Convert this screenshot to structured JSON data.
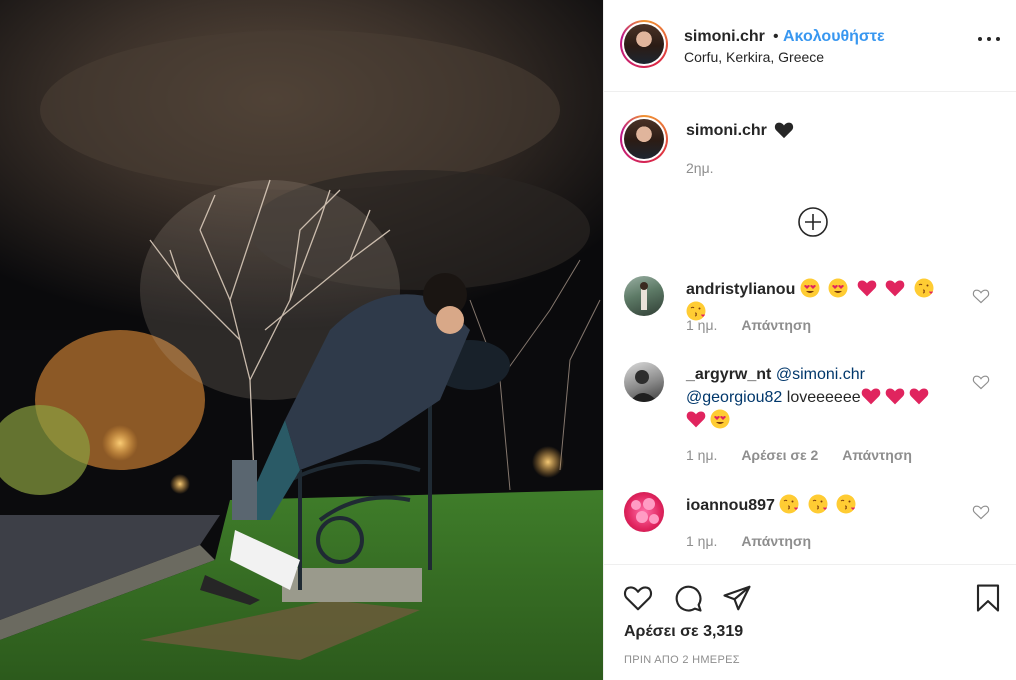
{
  "post": {
    "username": "simoni.chr",
    "dot": "•",
    "follow_label": "Ακολουθήστε",
    "location": "Corfu, Kerkira, Greece"
  },
  "caption": {
    "username": "simoni.chr",
    "emoji": "black-heart",
    "time": "2ημ."
  },
  "comments": [
    {
      "username": "andristylianou",
      "emojis": [
        "heart-eyes",
        "heart-eyes",
        "red-heart",
        "red-heart",
        "kissing-face",
        "kissing-face"
      ],
      "time": "1 ημ.",
      "reply_label": "Απάντηση"
    },
    {
      "username": "_argyrw_nt",
      "mention1": "@simoni.chr",
      "mention2": "@georgiou82",
      "text": "loveeeeee",
      "emojis_line1": [
        "red-heart",
        "red-heart",
        "red-heart"
      ],
      "emojis_line2": [
        "red-heart",
        "heart-eyes"
      ],
      "time": "1 ημ.",
      "likes_label": "Αρέσει σε 2",
      "reply_label": "Απάντηση"
    },
    {
      "username": "ioannou897",
      "emojis": [
        "kissing-face",
        "kissing-face",
        "kissing-face"
      ],
      "time": "1 ημ.",
      "reply_label": "Απάντηση"
    }
  ],
  "footer": {
    "likes": "Αρέσει σε 3,319",
    "date": "ΠΡΙΝ ΑΠΟ 2 ΗΜΕΡΕΣ"
  },
  "icons": {
    "more": "more-options-icon",
    "load_more": "plus-circle-icon",
    "like": "heart-outline-icon",
    "comment": "comment-bubble-icon",
    "share": "paper-plane-icon",
    "save": "bookmark-icon"
  },
  "colors": {
    "follow": "#3897f0",
    "text": "#262626",
    "secondary": "#8e8e8e",
    "mention": "#00376b",
    "heart_red": "#e0245e"
  }
}
